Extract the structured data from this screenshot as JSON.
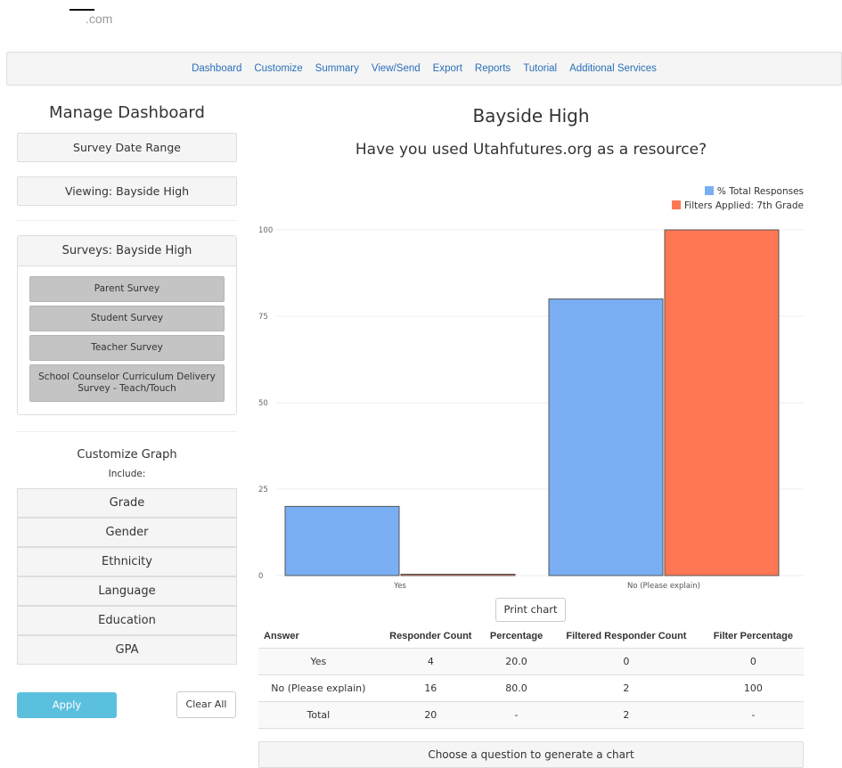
{
  "logo": {
    "text": ".com"
  },
  "nav": [
    "Dashboard",
    "Customize",
    "Summary",
    "View/Send",
    "Export",
    "Reports",
    "Tutorial",
    "Additional Services"
  ],
  "sidebar": {
    "title": "Manage Dashboard",
    "date_range_label": "Survey Date Range",
    "viewing_label": "Viewing: Bayside High",
    "surveys_header": "Surveys: Bayside High",
    "surveys": [
      "Parent Survey",
      "Student Survey",
      "Teacher Survey",
      "School Counselor Curriculum Delivery Survey - Teach/Touch"
    ],
    "customize_title": "Customize Graph",
    "include_label": "Include:",
    "filters": [
      "Grade",
      "Gender",
      "Ethnicity",
      "Language",
      "Education",
      "GPA"
    ],
    "apply_label": "Apply",
    "clear_label": "Clear All"
  },
  "main": {
    "title": "Bayside High",
    "question": "Have you used Utahfutures.org as a resource?",
    "print_label": "Print chart",
    "choose_label": "Choose a question to generate a chart"
  },
  "colors": {
    "blue": "#7aaef3",
    "orange": "#ff7653",
    "link": "#2a6fb8",
    "apply": "#5bc0de"
  },
  "chart_data": {
    "type": "bar",
    "categories": [
      "Yes",
      "No (Please explain)"
    ],
    "series": [
      {
        "name": "% Total Responses",
        "values": [
          20,
          80
        ],
        "color": "#7aaef3"
      },
      {
        "name": "Filters Applied: 7th Grade",
        "values": [
          0,
          100
        ],
        "color": "#ff7653"
      }
    ],
    "yticks": [
      0,
      25,
      50,
      75,
      100
    ],
    "ylim": [
      0,
      100
    ],
    "grid": true,
    "legend": "top-right"
  },
  "table": {
    "headers": [
      "Answer",
      "Responder Count",
      "Percentage",
      "Filtered Responder Count",
      "Filter Percentage"
    ],
    "rows": [
      [
        "Yes",
        "4",
        "20.0",
        "0",
        "0"
      ],
      [
        "No (Please explain)",
        "16",
        "80.0",
        "2",
        "100"
      ],
      [
        "Total",
        "20",
        "-",
        "2",
        "-"
      ]
    ]
  }
}
